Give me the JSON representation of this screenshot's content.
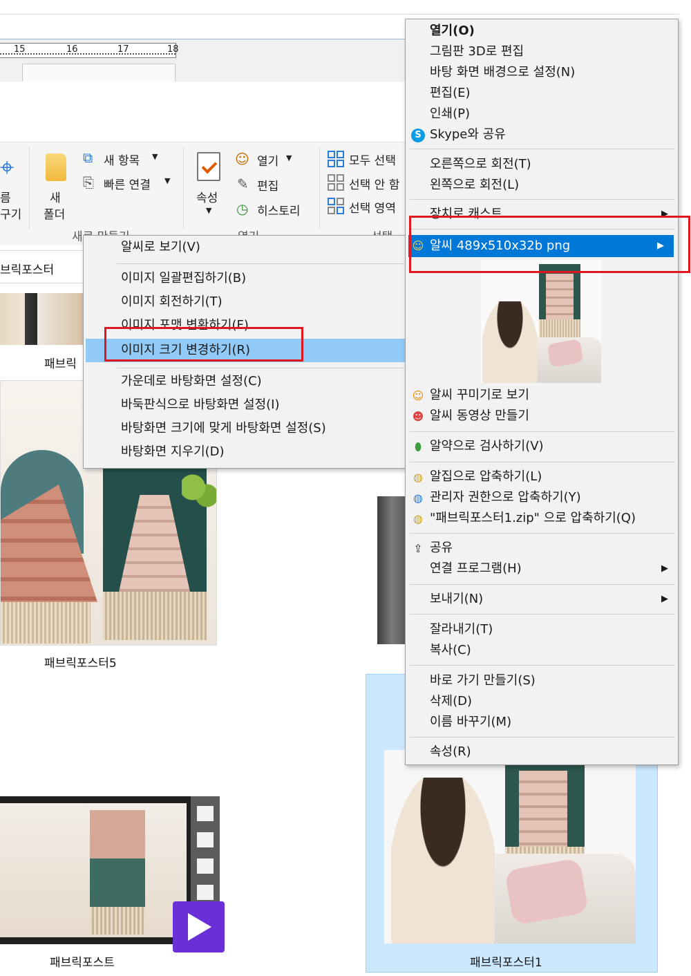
{
  "ruler": {
    "marks": [
      "15",
      "16",
      "17",
      "18"
    ]
  },
  "ribbon": {
    "left_partial_1": "름",
    "left_partial_2": "구기",
    "new_folder_line1": "새",
    "new_folder_line2": "폴더",
    "new_item": "새 항목",
    "easy_access": "빠른 연결",
    "group_new": "새로 만들기",
    "properties": "속성",
    "open": "열기",
    "edit": "편집",
    "history": "히스토리",
    "group_open": "열기",
    "select_all": "모두 선택",
    "select_none": "선택 안 함",
    "invert_select": "선택 영역",
    "group_select": "선택"
  },
  "address": {
    "partial": "브릭포스터"
  },
  "files": {
    "partial_label": "패브릭",
    "label_5": "패브릭포스터5",
    "label_video": "패브릭포스트",
    "label_1": "패브릭포스터1"
  },
  "main_menu": {
    "items": [
      "열기(O)",
      "그림판 3D로 편집",
      "바탕 화면 배경으로 설정(N)",
      "편집(E)",
      "인쇄(P)",
      "Skype와 공유",
      "오른쪽으로 회전(T)",
      "왼쪽으로 회전(L)",
      "장치로 캐스트",
      "알씨 489x510x32b png",
      "알씨 꾸미기로 보기",
      "알씨 동영상 만들기",
      "알약으로 검사하기(V)",
      "알집으로 압축하기(L)",
      "관리자 권한으로 압축하기(Y)",
      "\"패브릭포스터1.zip\" 으로 압축하기(Q)",
      "공유",
      "연결 프로그램(H)",
      "보내기(N)",
      "잘라내기(T)",
      "복사(C)",
      "바로 가기 만들기(S)",
      "삭제(D)",
      "이름 바꾸기(M)",
      "속성(R)"
    ]
  },
  "sub_menu": {
    "items": [
      "알씨로 보기(V)",
      "이미지 일괄편집하기(B)",
      "이미지 회전하기(T)",
      "이미지 포맷 변환하기(F)",
      "이미지 크기 변경하기(R)",
      "가운데로 바탕화면 설정(C)",
      "바둑판식으로 바탕화면 설정(I)",
      "바탕화면 크기에 맞게 바탕화면 설정(S)",
      "바탕화면 지우기(D)"
    ]
  },
  "icons": {
    "skype": "skype-icon",
    "alsee": "alsee-icon",
    "alyac": "alyac-icon",
    "alzip": "alzip-icon",
    "share": "share-icon",
    "submenu_arrow": "▶"
  },
  "colors": {
    "menu_bg": "#f2f2f2",
    "highlight_light": "#91c9f7",
    "highlight_dark": "#0078d7",
    "annotation_red": "#e0171e",
    "selection_bg": "#cce8ff"
  }
}
